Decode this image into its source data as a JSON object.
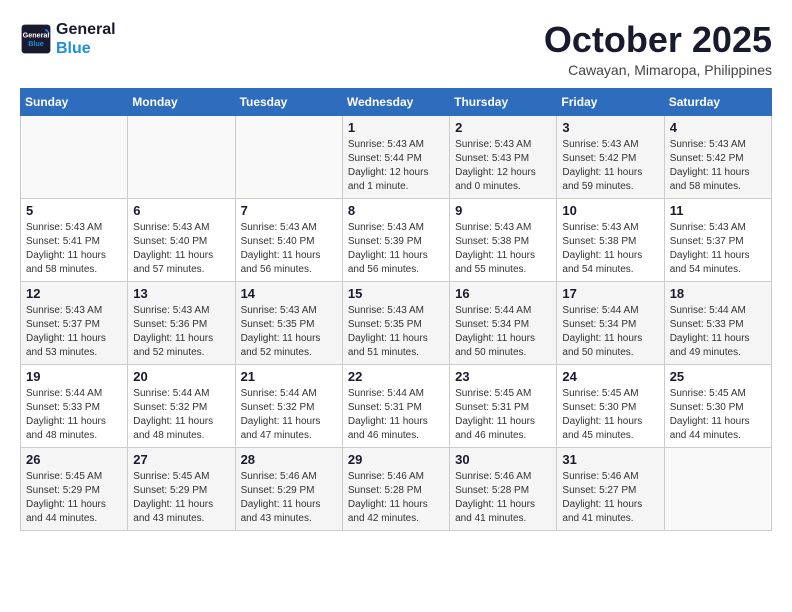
{
  "logo": {
    "line1": "General",
    "line2": "Blue"
  },
  "title": "October 2025",
  "subtitle": "Cawayan, Mimaropa, Philippines",
  "weekdays": [
    "Sunday",
    "Monday",
    "Tuesday",
    "Wednesday",
    "Thursday",
    "Friday",
    "Saturday"
  ],
  "weeks": [
    [
      {
        "day": "",
        "info": ""
      },
      {
        "day": "",
        "info": ""
      },
      {
        "day": "",
        "info": ""
      },
      {
        "day": "1",
        "info": "Sunrise: 5:43 AM\nSunset: 5:44 PM\nDaylight: 12 hours\nand 1 minute."
      },
      {
        "day": "2",
        "info": "Sunrise: 5:43 AM\nSunset: 5:43 PM\nDaylight: 12 hours\nand 0 minutes."
      },
      {
        "day": "3",
        "info": "Sunrise: 5:43 AM\nSunset: 5:42 PM\nDaylight: 11 hours\nand 59 minutes."
      },
      {
        "day": "4",
        "info": "Sunrise: 5:43 AM\nSunset: 5:42 PM\nDaylight: 11 hours\nand 58 minutes."
      }
    ],
    [
      {
        "day": "5",
        "info": "Sunrise: 5:43 AM\nSunset: 5:41 PM\nDaylight: 11 hours\nand 58 minutes."
      },
      {
        "day": "6",
        "info": "Sunrise: 5:43 AM\nSunset: 5:40 PM\nDaylight: 11 hours\nand 57 minutes."
      },
      {
        "day": "7",
        "info": "Sunrise: 5:43 AM\nSunset: 5:40 PM\nDaylight: 11 hours\nand 56 minutes."
      },
      {
        "day": "8",
        "info": "Sunrise: 5:43 AM\nSunset: 5:39 PM\nDaylight: 11 hours\nand 56 minutes."
      },
      {
        "day": "9",
        "info": "Sunrise: 5:43 AM\nSunset: 5:38 PM\nDaylight: 11 hours\nand 55 minutes."
      },
      {
        "day": "10",
        "info": "Sunrise: 5:43 AM\nSunset: 5:38 PM\nDaylight: 11 hours\nand 54 minutes."
      },
      {
        "day": "11",
        "info": "Sunrise: 5:43 AM\nSunset: 5:37 PM\nDaylight: 11 hours\nand 54 minutes."
      }
    ],
    [
      {
        "day": "12",
        "info": "Sunrise: 5:43 AM\nSunset: 5:37 PM\nDaylight: 11 hours\nand 53 minutes."
      },
      {
        "day": "13",
        "info": "Sunrise: 5:43 AM\nSunset: 5:36 PM\nDaylight: 11 hours\nand 52 minutes."
      },
      {
        "day": "14",
        "info": "Sunrise: 5:43 AM\nSunset: 5:35 PM\nDaylight: 11 hours\nand 52 minutes."
      },
      {
        "day": "15",
        "info": "Sunrise: 5:43 AM\nSunset: 5:35 PM\nDaylight: 11 hours\nand 51 minutes."
      },
      {
        "day": "16",
        "info": "Sunrise: 5:44 AM\nSunset: 5:34 PM\nDaylight: 11 hours\nand 50 minutes."
      },
      {
        "day": "17",
        "info": "Sunrise: 5:44 AM\nSunset: 5:34 PM\nDaylight: 11 hours\nand 50 minutes."
      },
      {
        "day": "18",
        "info": "Sunrise: 5:44 AM\nSunset: 5:33 PM\nDaylight: 11 hours\nand 49 minutes."
      }
    ],
    [
      {
        "day": "19",
        "info": "Sunrise: 5:44 AM\nSunset: 5:33 PM\nDaylight: 11 hours\nand 48 minutes."
      },
      {
        "day": "20",
        "info": "Sunrise: 5:44 AM\nSunset: 5:32 PM\nDaylight: 11 hours\nand 48 minutes."
      },
      {
        "day": "21",
        "info": "Sunrise: 5:44 AM\nSunset: 5:32 PM\nDaylight: 11 hours\nand 47 minutes."
      },
      {
        "day": "22",
        "info": "Sunrise: 5:44 AM\nSunset: 5:31 PM\nDaylight: 11 hours\nand 46 minutes."
      },
      {
        "day": "23",
        "info": "Sunrise: 5:45 AM\nSunset: 5:31 PM\nDaylight: 11 hours\nand 46 minutes."
      },
      {
        "day": "24",
        "info": "Sunrise: 5:45 AM\nSunset: 5:30 PM\nDaylight: 11 hours\nand 45 minutes."
      },
      {
        "day": "25",
        "info": "Sunrise: 5:45 AM\nSunset: 5:30 PM\nDaylight: 11 hours\nand 44 minutes."
      }
    ],
    [
      {
        "day": "26",
        "info": "Sunrise: 5:45 AM\nSunset: 5:29 PM\nDaylight: 11 hours\nand 44 minutes."
      },
      {
        "day": "27",
        "info": "Sunrise: 5:45 AM\nSunset: 5:29 PM\nDaylight: 11 hours\nand 43 minutes."
      },
      {
        "day": "28",
        "info": "Sunrise: 5:46 AM\nSunset: 5:29 PM\nDaylight: 11 hours\nand 43 minutes."
      },
      {
        "day": "29",
        "info": "Sunrise: 5:46 AM\nSunset: 5:28 PM\nDaylight: 11 hours\nand 42 minutes."
      },
      {
        "day": "30",
        "info": "Sunrise: 5:46 AM\nSunset: 5:28 PM\nDaylight: 11 hours\nand 41 minutes."
      },
      {
        "day": "31",
        "info": "Sunrise: 5:46 AM\nSunset: 5:27 PM\nDaylight: 11 hours\nand 41 minutes."
      },
      {
        "day": "",
        "info": ""
      }
    ]
  ]
}
